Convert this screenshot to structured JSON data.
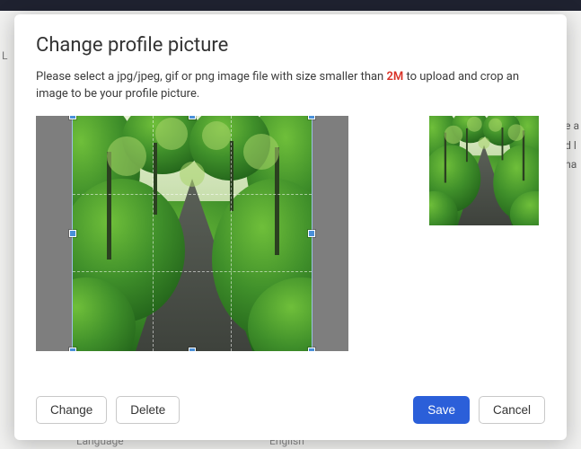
{
  "modal": {
    "title": "Change profile picture",
    "help_pre": "Please select a jpg/jpeg, gif or png image file with size smaller than ",
    "help_em": "2M",
    "help_post": " to upload and crop an image to be your profile picture."
  },
  "buttons": {
    "change": "Change",
    "delete": "Delete",
    "save": "Save",
    "cancel": "Cancel"
  },
  "background": {
    "left_label": "L",
    "right_frag_1": "e a",
    "right_frag_2": "d l",
    "right_frag_3": "ha",
    "bottom_label_1": "Language",
    "bottom_label_2": "English"
  }
}
